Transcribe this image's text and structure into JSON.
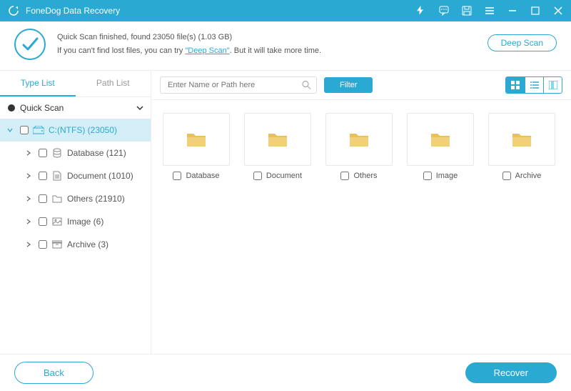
{
  "app": {
    "title": "FoneDog Data Recovery"
  },
  "banner": {
    "line1_prefix": "Quick Scan finished, found ",
    "file_count": "23050",
    "line1_mid": " file(s) (",
    "total_size": "1.03 GB",
    "line1_suffix": ")",
    "line2_prefix": "If you can't find lost files, you can try ",
    "deep_scan_link": "\"Deep Scan\"",
    "line2_suffix": ". But it will take more time.",
    "deep_scan_button": "Deep Scan"
  },
  "tabs": {
    "type_list": "Type List",
    "path_list": "Path List"
  },
  "tree": {
    "root": "Quick Scan",
    "drive": "C:(NTFS) (23050)",
    "children": [
      {
        "label": "Database (121)"
      },
      {
        "label": "Document (1010)"
      },
      {
        "label": "Others (21910)"
      },
      {
        "label": "Image (6)"
      },
      {
        "label": "Archive (3)"
      }
    ]
  },
  "toolbar": {
    "search_placeholder": "Enter Name or Path here",
    "filter": "Filter"
  },
  "folders": [
    {
      "label": "Database"
    },
    {
      "label": "Document"
    },
    {
      "label": "Others"
    },
    {
      "label": "Image"
    },
    {
      "label": "Archive"
    }
  ],
  "footer": {
    "back": "Back",
    "recover": "Recover"
  }
}
